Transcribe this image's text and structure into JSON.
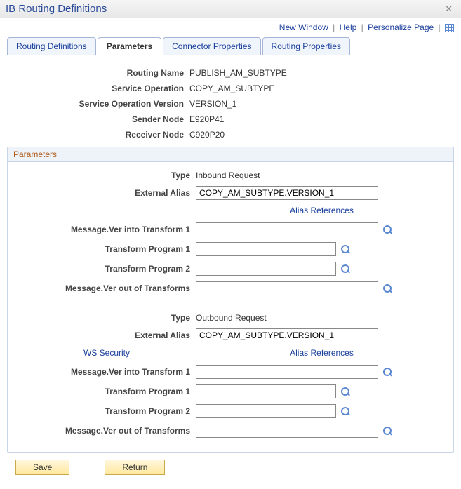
{
  "page": {
    "title": "IB Routing Definitions"
  },
  "toplinks": {
    "new_window": "New Window",
    "help": "Help",
    "personalize": "Personalize Page"
  },
  "tabs": [
    {
      "label": "Routing Definitions"
    },
    {
      "label": "Parameters"
    },
    {
      "label": "Connector Properties"
    },
    {
      "label": "Routing Properties"
    }
  ],
  "header": {
    "routing_name_lbl": "Routing Name",
    "routing_name_val": "PUBLISH_AM_SUBTYPE",
    "service_op_lbl": "Service Operation",
    "service_op_val": "COPY_AM_SUBTYPE",
    "service_op_ver_lbl": "Service Operation Version",
    "service_op_ver_val": "VERSION_1",
    "sender_node_lbl": "Sender Node",
    "sender_node_val": "E920P41",
    "receiver_node_lbl": "Receiver Node",
    "receiver_node_val": "C920P20"
  },
  "group_title": "Parameters",
  "common": {
    "type_lbl": "Type",
    "ext_alias_lbl": "External Alias",
    "alias_ref": "Alias References",
    "ws_security": "WS Security",
    "msg_in_lbl": "Message.Ver into Transform 1",
    "tprog1_lbl": "Transform Program 1",
    "tprog2_lbl": "Transform Program 2",
    "msg_out_lbl": "Message.Ver out of Transforms"
  },
  "inbound": {
    "type_val": "Inbound Request",
    "ext_alias_val": "COPY_AM_SUBTYPE.VERSION_1",
    "msg_in_val": "",
    "tprog1_val": "",
    "tprog2_val": "",
    "msg_out_val": ""
  },
  "outbound": {
    "type_val": "Outbound Request",
    "ext_alias_val": "COPY_AM_SUBTYPE.VERSION_1",
    "msg_in_val": "",
    "tprog1_val": "",
    "tprog2_val": "",
    "msg_out_val": ""
  },
  "buttons": {
    "save": "Save",
    "return": "Return"
  }
}
